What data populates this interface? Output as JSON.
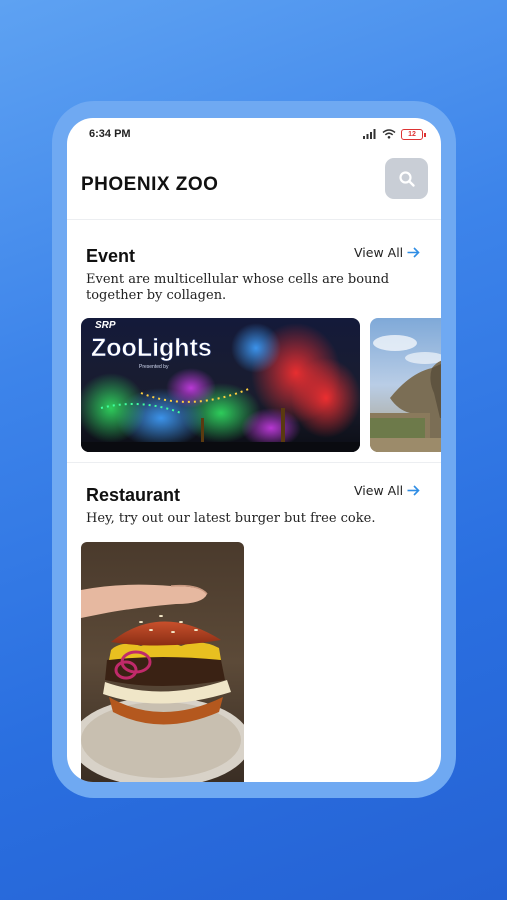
{
  "status": {
    "time": "6:34 PM",
    "battery": "12"
  },
  "header": {
    "title": "PHOENIX ZOO"
  },
  "event": {
    "title": "Event",
    "view_all": "View All",
    "description": "Event are multicellular whose cells are bound together by collagen.",
    "card_logo": "ZooLights",
    "card_brand": "SRP",
    "card_sub": "Presented by"
  },
  "restaurant": {
    "title": "Restaurant",
    "view_all": "View All",
    "description": "Hey, try out our latest burger but free coke."
  },
  "icons": {
    "search": "search-icon",
    "arrow": "arrow-right-icon",
    "signal": "signal-icon",
    "wifi": "wifi-icon",
    "battery": "battery-icon"
  },
  "colors": {
    "background": "#3d84ea",
    "frame": "#6fa9f2",
    "accent": "#2f8de4",
    "search_button": "#c9ced6"
  }
}
